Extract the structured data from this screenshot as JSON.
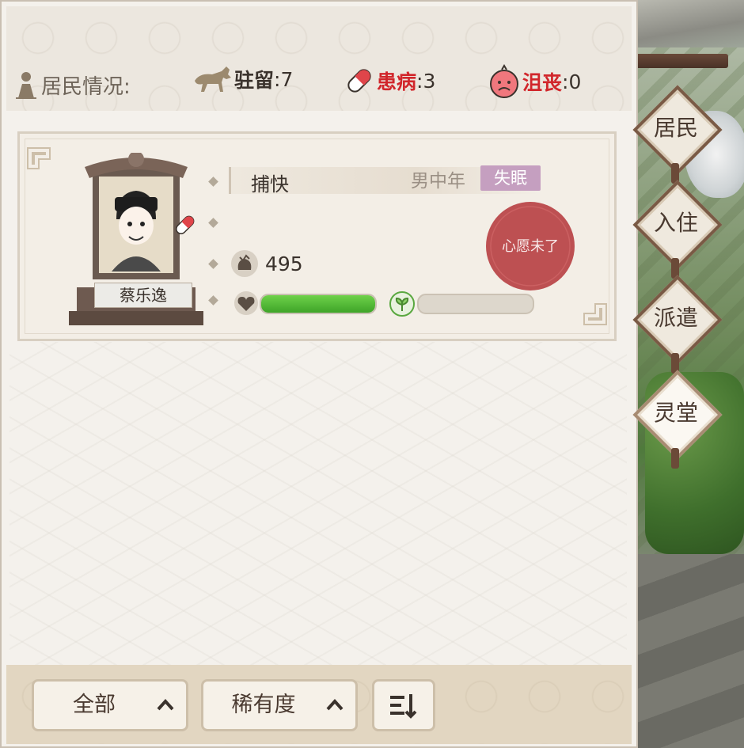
{
  "header": {
    "residents_label": "居民情况:",
    "stay": {
      "label": "驻留",
      "sep": ":",
      "value": "7"
    },
    "sick": {
      "label": "患病",
      "sep": ":",
      "value": "3"
    },
    "depressed": {
      "label": "沮丧",
      "sep": ":",
      "value": "0"
    }
  },
  "resident": {
    "name": "蔡乐逸",
    "job": "捕快",
    "gender_age": "男中年",
    "trait": "失眠",
    "money": "495",
    "health_fraction": 1.0,
    "mood_fraction": 0.0,
    "seal_text": "心愿未了"
  },
  "side_tabs": [
    {
      "label": "居民"
    },
    {
      "label": "入住"
    },
    {
      "label": "派遣"
    },
    {
      "label": "灵堂"
    }
  ],
  "footer": {
    "filter_all": "全部",
    "filter_rarity": "稀有度"
  },
  "colors": {
    "accent_red": "#d1262b",
    "trait_purple": "#c59fc0",
    "health_green": "#3ea428"
  }
}
